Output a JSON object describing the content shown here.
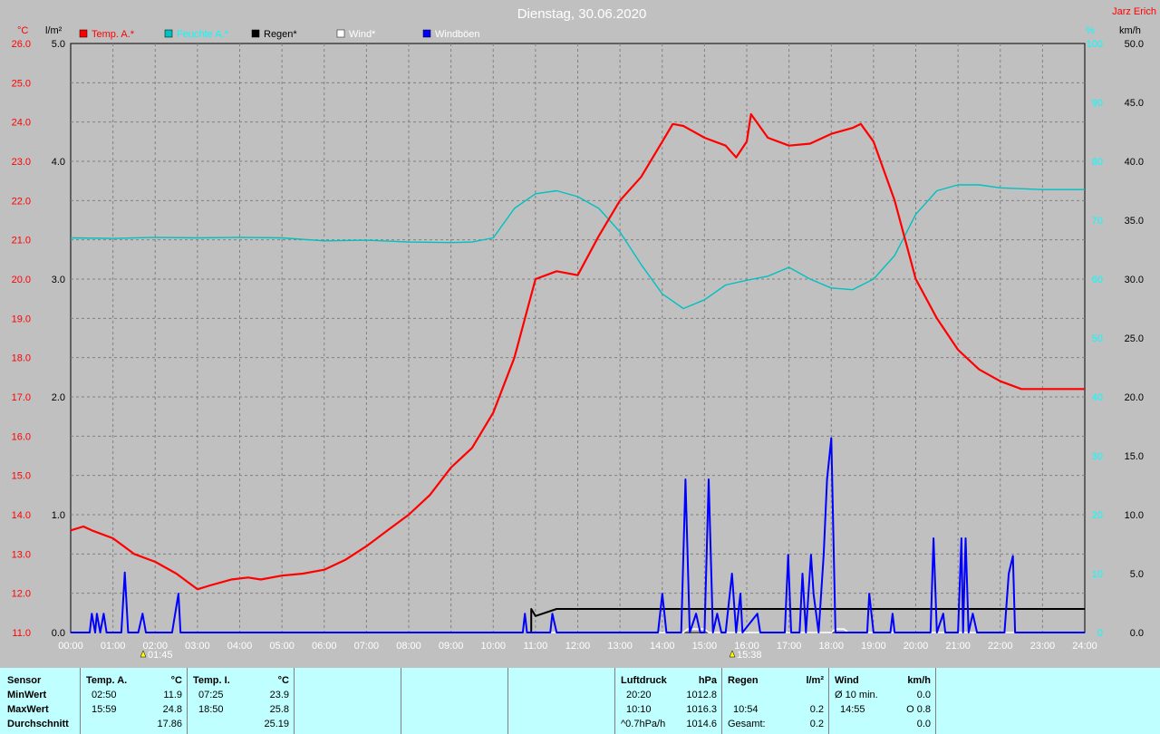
{
  "title": "Dienstag, 30.06.2020",
  "author": "Jarz Erich",
  "unit_labels": {
    "left_temp": "°C",
    "left_rain": "l/m²",
    "right_pressure": "%",
    "right_wind": "km/h"
  },
  "colors": {
    "temp": "#ff0000",
    "pressure": "#00c0c0",
    "rain": "#000000",
    "wind": "#ffffff",
    "gust": "#0000ff"
  },
  "events": {
    "sunrise": "01:45",
    "sunset": "15:38"
  },
  "chart_data": {
    "type": "line",
    "x_ticks": [
      "00:00",
      "01:00",
      "02:00",
      "03:00",
      "04:00",
      "05:00",
      "06:00",
      "07:00",
      "08:00",
      "09:00",
      "10:00",
      "11:00",
      "12:00",
      "13:00",
      "14:00",
      "15:00",
      "16:00",
      "17:00",
      "18:00",
      "19:00",
      "20:00",
      "21:00",
      "22:00",
      "23:00",
      "24:00"
    ],
    "axes": {
      "temp": {
        "min": 11.0,
        "max": 26.0,
        "ticks": [
          "11.0",
          "12.0",
          "13.0",
          "14.0",
          "15.0",
          "16.0",
          "17.0",
          "18.0",
          "19.0",
          "20.0",
          "21.0",
          "22.0",
          "23.0",
          "24.0",
          "25.0",
          "26.0"
        ]
      },
      "rain": {
        "min": 0,
        "max": 5,
        "ticks": [
          "0.0",
          "1.0",
          "2.0",
          "3.0",
          "4.0",
          "5.0"
        ]
      },
      "pressure": {
        "min": 0,
        "max": 100,
        "ticks": [
          "0",
          "10",
          "20",
          "30",
          "40",
          "50",
          "60",
          "70",
          "80",
          "90",
          "100"
        ]
      },
      "wind": {
        "min": 0,
        "max": 50,
        "ticks": [
          "0.0",
          "5.0",
          "10.0",
          "15.0",
          "20.0",
          "25.0",
          "30.0",
          "35.0",
          "40.0",
          "45.0",
          "50.0"
        ]
      }
    },
    "legend": [
      "Temp. A.*",
      "Feuchte A.*",
      "Regen*",
      "Wind*",
      "Windböen"
    ],
    "series": [
      {
        "name": "Temp. A.*",
        "axis": "temp",
        "points": [
          [
            0,
            13.6
          ],
          [
            0.3,
            13.7
          ],
          [
            0.5,
            13.6
          ],
          [
            1.0,
            13.4
          ],
          [
            1.5,
            13.0
          ],
          [
            2.0,
            12.8
          ],
          [
            2.5,
            12.5
          ],
          [
            3.0,
            12.1
          ],
          [
            3.3,
            12.2
          ],
          [
            3.8,
            12.35
          ],
          [
            4.2,
            12.4
          ],
          [
            4.5,
            12.35
          ],
          [
            5.0,
            12.45
          ],
          [
            5.5,
            12.5
          ],
          [
            6.0,
            12.6
          ],
          [
            6.5,
            12.85
          ],
          [
            7.0,
            13.2
          ],
          [
            7.5,
            13.6
          ],
          [
            8.0,
            14.0
          ],
          [
            8.5,
            14.5
          ],
          [
            9.0,
            15.2
          ],
          [
            9.5,
            15.7
          ],
          [
            10.0,
            16.6
          ],
          [
            10.5,
            18.0
          ],
          [
            11.0,
            20.0
          ],
          [
            11.5,
            20.2
          ],
          [
            12.0,
            20.1
          ],
          [
            12.5,
            21.1
          ],
          [
            13.0,
            22.0
          ],
          [
            13.5,
            22.6
          ],
          [
            14.0,
            23.5
          ],
          [
            14.25,
            23.95
          ],
          [
            14.5,
            23.9
          ],
          [
            15.0,
            23.6
          ],
          [
            15.5,
            23.4
          ],
          [
            15.75,
            23.1
          ],
          [
            16.0,
            23.5
          ],
          [
            16.1,
            24.2
          ],
          [
            16.5,
            23.6
          ],
          [
            17.0,
            23.4
          ],
          [
            17.5,
            23.45
          ],
          [
            18.0,
            23.7
          ],
          [
            18.5,
            23.85
          ],
          [
            18.7,
            23.95
          ],
          [
            19.0,
            23.5
          ],
          [
            19.5,
            22.0
          ],
          [
            20.0,
            20.0
          ],
          [
            20.5,
            19.0
          ],
          [
            21.0,
            18.2
          ],
          [
            21.5,
            17.7
          ],
          [
            22.0,
            17.4
          ],
          [
            22.5,
            17.2
          ],
          [
            23.0,
            17.2
          ],
          [
            23.5,
            17.2
          ],
          [
            24.0,
            17.2
          ]
        ]
      },
      {
        "name": "Feuchte A.*",
        "axis": "pressure",
        "points": [
          [
            0,
            67.0
          ],
          [
            1.0,
            66.9
          ],
          [
            2.0,
            67.1
          ],
          [
            3.0,
            67.0
          ],
          [
            4.0,
            67.1
          ],
          [
            5.0,
            67.0
          ],
          [
            6.0,
            66.5
          ],
          [
            7.0,
            66.6
          ],
          [
            8.0,
            66.3
          ],
          [
            9.0,
            66.2
          ],
          [
            9.5,
            66.3
          ],
          [
            10.0,
            67.0
          ],
          [
            10.5,
            72.0
          ],
          [
            11.0,
            74.5
          ],
          [
            11.5,
            75.0
          ],
          [
            12.0,
            74.0
          ],
          [
            12.5,
            72.0
          ],
          [
            13.0,
            68.0
          ],
          [
            13.5,
            62.5
          ],
          [
            14.0,
            57.5
          ],
          [
            14.5,
            55.0
          ],
          [
            15.0,
            56.5
          ],
          [
            15.5,
            59.0
          ],
          [
            16.0,
            59.8
          ],
          [
            16.5,
            60.5
          ],
          [
            17.0,
            62.0
          ],
          [
            17.5,
            60.0
          ],
          [
            18.0,
            58.5
          ],
          [
            18.5,
            58.2
          ],
          [
            19.0,
            60.0
          ],
          [
            19.5,
            64.0
          ],
          [
            20.0,
            71.0
          ],
          [
            20.5,
            75.0
          ],
          [
            21.0,
            76.0
          ],
          [
            21.5,
            76.0
          ],
          [
            22.0,
            75.5
          ],
          [
            23.0,
            75.2
          ],
          [
            24.0,
            75.2
          ]
        ]
      },
      {
        "name": "Regen*",
        "axis": "rain",
        "points": [
          [
            0,
            0
          ],
          [
            10.9,
            0
          ],
          [
            10.9,
            0.2
          ],
          [
            11.0,
            0.14
          ],
          [
            11.5,
            0.2
          ],
          [
            12.0,
            0.2
          ],
          [
            24.0,
            0.2
          ]
        ]
      },
      {
        "name": "Wind*",
        "axis": "wind",
        "points": [
          [
            0,
            0
          ],
          [
            14.5,
            0
          ],
          [
            14.6,
            0.3
          ],
          [
            15.0,
            0.3
          ],
          [
            15.1,
            0
          ],
          [
            18.0,
            0
          ],
          [
            18.1,
            0.3
          ],
          [
            18.3,
            0.3
          ],
          [
            18.4,
            0
          ],
          [
            24.0,
            0
          ]
        ]
      },
      {
        "name": "Windböen",
        "axis": "wind",
        "points": [
          [
            0,
            0
          ],
          [
            0.45,
            0
          ],
          [
            0.5,
            1.6
          ],
          [
            0.58,
            0
          ],
          [
            0.62,
            1.6
          ],
          [
            0.7,
            0
          ],
          [
            0.78,
            1.6
          ],
          [
            0.85,
            0
          ],
          [
            1.2,
            0
          ],
          [
            1.28,
            5.1
          ],
          [
            1.36,
            0
          ],
          [
            1.6,
            0
          ],
          [
            1.7,
            1.6
          ],
          [
            1.78,
            0
          ],
          [
            2.4,
            0
          ],
          [
            2.55,
            3.3
          ],
          [
            2.6,
            0
          ],
          [
            10.7,
            0
          ],
          [
            10.75,
            1.6
          ],
          [
            10.8,
            0
          ],
          [
            11.35,
            0
          ],
          [
            11.4,
            1.6
          ],
          [
            11.5,
            0
          ],
          [
            13.9,
            0
          ],
          [
            14.0,
            3.3
          ],
          [
            14.1,
            0
          ],
          [
            14.45,
            0
          ],
          [
            14.55,
            13.0
          ],
          [
            14.65,
            0
          ],
          [
            14.8,
            1.6
          ],
          [
            14.9,
            0
          ],
          [
            15.0,
            0
          ],
          [
            15.1,
            13.0
          ],
          [
            15.2,
            0
          ],
          [
            15.3,
            1.6
          ],
          [
            15.4,
            0
          ],
          [
            15.5,
            0
          ],
          [
            15.65,
            5.0
          ],
          [
            15.75,
            0
          ],
          [
            15.85,
            3.3
          ],
          [
            15.9,
            0
          ],
          [
            16.25,
            1.6
          ],
          [
            16.32,
            0
          ],
          [
            16.9,
            0
          ],
          [
            16.98,
            6.6
          ],
          [
            17.05,
            0
          ],
          [
            17.25,
            0
          ],
          [
            17.32,
            5.0
          ],
          [
            17.4,
            0
          ],
          [
            17.52,
            6.6
          ],
          [
            17.58,
            3.3
          ],
          [
            17.7,
            0
          ],
          [
            17.82,
            6.6
          ],
          [
            17.9,
            13.0
          ],
          [
            18.0,
            16.5
          ],
          [
            18.1,
            0
          ],
          [
            18.85,
            0
          ],
          [
            18.9,
            3.3
          ],
          [
            19.0,
            0
          ],
          [
            19.4,
            0
          ],
          [
            19.45,
            1.6
          ],
          [
            19.5,
            0
          ],
          [
            20.35,
            0
          ],
          [
            20.42,
            8.0
          ],
          [
            20.5,
            0
          ],
          [
            20.65,
            1.6
          ],
          [
            20.7,
            0
          ],
          [
            21.0,
            0
          ],
          [
            21.08,
            8.0
          ],
          [
            21.12,
            0
          ],
          [
            21.18,
            8.0
          ],
          [
            21.25,
            0
          ],
          [
            21.35,
            1.6
          ],
          [
            21.45,
            0
          ],
          [
            22.1,
            0
          ],
          [
            22.2,
            5.0
          ],
          [
            22.3,
            6.5
          ],
          [
            22.35,
            0
          ],
          [
            24.0,
            0
          ]
        ]
      }
    ]
  },
  "stats": {
    "sensor": {
      "h1": "Sensor",
      "rows": [
        "MinWert",
        "MaxWert",
        "Durchschnitt"
      ]
    },
    "temp_a": {
      "h": "Temp. A.",
      "unit": "°C",
      "rows": [
        [
          "02:50",
          "11.9"
        ],
        [
          "15:59",
          "24.8"
        ],
        [
          "",
          "17.86"
        ]
      ]
    },
    "temp_i": {
      "h": "Temp. I.",
      "unit": "°C",
      "rows": [
        [
          "07:25",
          "23.9"
        ],
        [
          "18:50",
          "25.8"
        ],
        [
          "",
          "25.19"
        ]
      ]
    },
    "pressure": {
      "h": "Luftdruck",
      "unit": "hPa",
      "rows": [
        [
          "20:20",
          "1012.8"
        ],
        [
          "10:10",
          "1016.3"
        ],
        [
          "^0.7hPa/h",
          "1014.6"
        ]
      ]
    },
    "rain": {
      "h": "Regen",
      "unit": "l/m²",
      "rows": [
        [
          "",
          ""
        ],
        [
          "10:54",
          "0.2"
        ],
        [
          "Gesamt:",
          "0.2"
        ]
      ]
    },
    "wind": {
      "h": "Wind",
      "unit": "km/h",
      "rows": [
        [
          "Ø 10 min.",
          "0.0"
        ],
        [
          "14:55",
          "O 0.8"
        ],
        [
          "",
          "0.0"
        ]
      ]
    }
  }
}
